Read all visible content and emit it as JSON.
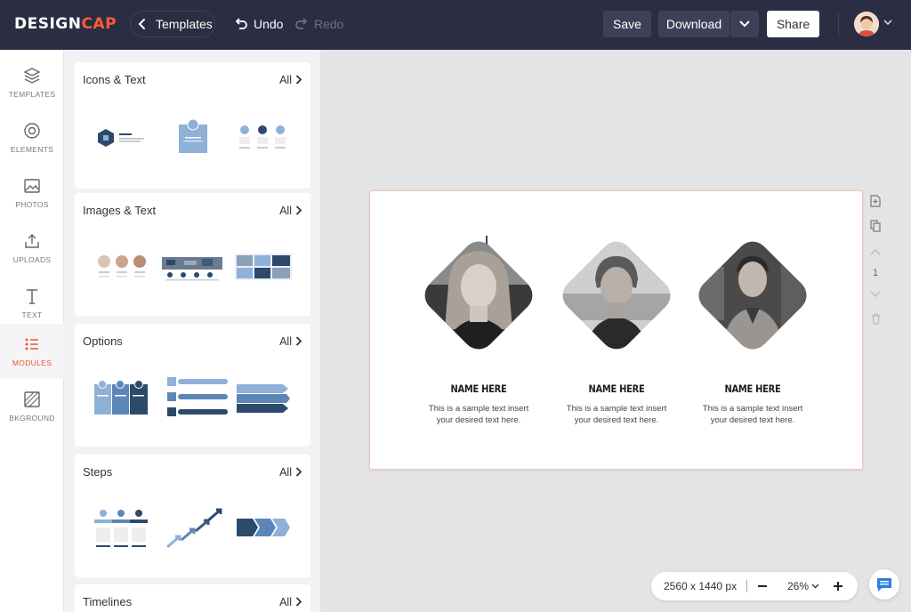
{
  "app": {
    "logo_main": "DESIGN",
    "logo_accent": "CAP",
    "brand_color": "#ff5a36",
    "topbar_color": "#2b2d42"
  },
  "topbar": {
    "back_label": "Templates",
    "undo_label": "Undo",
    "redo_label": "Redo",
    "save_label": "Save",
    "download_label": "Download",
    "share_label": "Share"
  },
  "leftnav": {
    "active_color": "#e8562a",
    "items": [
      {
        "label": "TEMPLATES",
        "icon": "layers-icon"
      },
      {
        "label": "ELEMENTS",
        "icon": "shapes-icon"
      },
      {
        "label": "PHOTOS",
        "icon": "image-icon"
      },
      {
        "label": "UPLOADS",
        "icon": "upload-icon"
      },
      {
        "label": "TEXT",
        "icon": "text-icon"
      },
      {
        "label": "MODULES",
        "icon": "list-icon",
        "active": true
      },
      {
        "label": "BKGROUND",
        "icon": "background-icon"
      }
    ]
  },
  "panel": {
    "sections": [
      {
        "title": "Icons & Text",
        "all_label": "All"
      },
      {
        "title": "Images & Text",
        "all_label": "All"
      },
      {
        "title": "Options",
        "all_label": "All"
      },
      {
        "title": "Steps",
        "all_label": "All"
      },
      {
        "title": "Timelines",
        "all_label": "All"
      }
    ]
  },
  "canvas": {
    "people": [
      {
        "name": "NAME HERE",
        "desc_line1": "This is a sample text insert",
        "desc_line2": "your desired text here."
      },
      {
        "name": "NAME HERE",
        "desc_line1": "This is a sample text insert",
        "desc_line2": "your desired text here."
      },
      {
        "name": "NAME HERE",
        "desc_line1": "This is a sample text insert",
        "desc_line2": "your desired text here."
      }
    ]
  },
  "page_tools": {
    "page_number": "1"
  },
  "zoombar": {
    "canvas_size": "2560 x 1440 px",
    "zoom_level": "26%"
  }
}
